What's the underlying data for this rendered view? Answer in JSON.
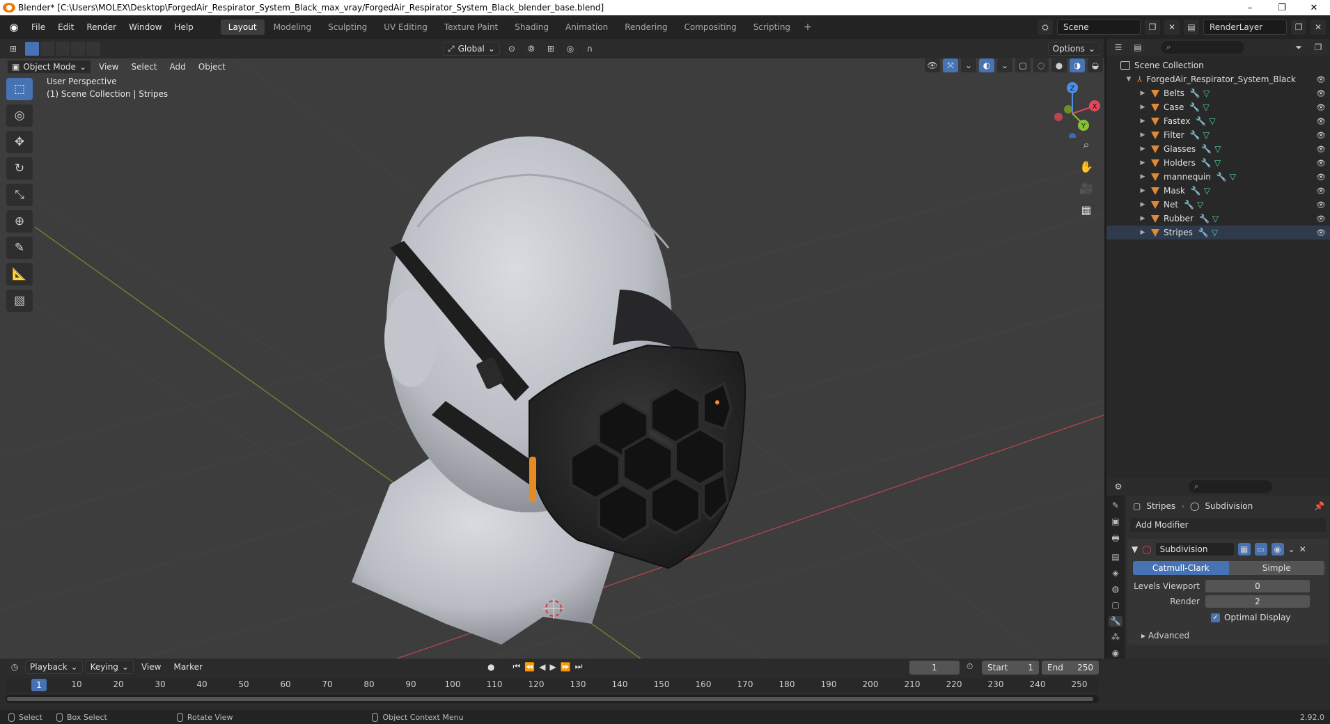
{
  "window": {
    "title": "Blender* [C:\\Users\\MOLEX\\Desktop\\ForgedAir_Respirator_System_Black_max_vray/ForgedAir_Respirator_System_Black_blender_base.blend]",
    "minimize": "–",
    "maximize": "❐",
    "close": "✕"
  },
  "menubar": {
    "menus": [
      "File",
      "Edit",
      "Render",
      "Window",
      "Help"
    ],
    "workspaces": [
      "Layout",
      "Modeling",
      "Sculpting",
      "UV Editing",
      "Texture Paint",
      "Shading",
      "Animation",
      "Rendering",
      "Compositing",
      "Scripting"
    ],
    "active_workspace": "Layout",
    "add_tab": "+",
    "scene": "Scene",
    "view_layer": "RenderLayer"
  },
  "viewport": {
    "mode": "Object Mode",
    "menus": [
      "View",
      "Select",
      "Add",
      "Object"
    ],
    "transform_orientation": "Global",
    "options": "Options",
    "perspective_label": "User Perspective",
    "context_label": "(1) Scene Collection | Stripes",
    "gizmo": {
      "x": "X",
      "y": "Y",
      "z": "Z"
    }
  },
  "outliner": {
    "root": "Scene Collection",
    "collection": "ForgedAir_Respirator_System_Black",
    "objects": [
      "Belts",
      "Case",
      "Fastex",
      "Filter",
      "Glasses",
      "Holders",
      "mannequin",
      "Mask",
      "Net",
      "Rubber",
      "Stripes"
    ],
    "selected": "Stripes"
  },
  "properties": {
    "object": "Stripes",
    "modifier_context": "Subdivision",
    "add_modifier": "Add Modifier",
    "modifier": {
      "name": "Subdivision",
      "type_options": [
        "Catmull-Clark",
        "Simple"
      ],
      "type_selected": "Catmull-Clark",
      "levels_viewport_label": "Levels Viewport",
      "levels_viewport": "0",
      "render_label": "Render",
      "render": "2",
      "optimal_display_label": "Optimal Display",
      "optimal_display": true,
      "advanced": "Advanced"
    }
  },
  "timeline": {
    "menus": [
      "Playback",
      "Keying",
      "View",
      "Marker"
    ],
    "current_frame": "1",
    "start_label": "Start",
    "start": "1",
    "end_label": "End",
    "end": "250",
    "ticks": [
      "10",
      "20",
      "30",
      "40",
      "50",
      "60",
      "70",
      "80",
      "90",
      "100",
      "110",
      "120",
      "130",
      "140",
      "150",
      "160",
      "170",
      "180",
      "190",
      "200",
      "210",
      "220",
      "230",
      "240",
      "250"
    ]
  },
  "statusbar": {
    "select": "Select",
    "box_select": "Box Select",
    "rotate_view": "Rotate View",
    "context_menu": "Object Context Menu",
    "version": "2.92.0"
  },
  "colors": {
    "accent": "#4772b3",
    "object_orange": "#e08a37",
    "viewport_bg": "#3d3d3d",
    "x_axis": "#e4475a",
    "y_axis": "#86bf38",
    "z_axis": "#4f8ee8"
  }
}
